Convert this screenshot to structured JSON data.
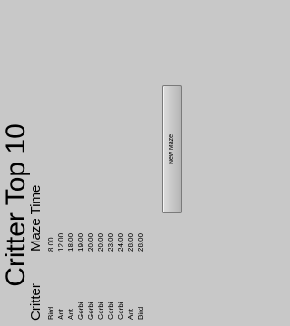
{
  "title": "Critter Top 10",
  "headers": {
    "critter": "Critter",
    "maze_time": "Maze Time"
  },
  "rows": [
    {
      "critter": "Bird",
      "time": "8.00"
    },
    {
      "critter": "Ant",
      "time": "12.00"
    },
    {
      "critter": "Ant",
      "time": "18.00"
    },
    {
      "critter": "Gerbil",
      "time": "19.00"
    },
    {
      "critter": "Gerbil",
      "time": "20.00"
    },
    {
      "critter": "Gerbil",
      "time": "20.00"
    },
    {
      "critter": "Gerbil",
      "time": "23.00"
    },
    {
      "critter": "Gerbil",
      "time": "24.00"
    },
    {
      "critter": "Ant",
      "time": "28.00"
    },
    {
      "critter": "Bird",
      "time": "28.00"
    }
  ],
  "new_maze_label": "New Maze"
}
